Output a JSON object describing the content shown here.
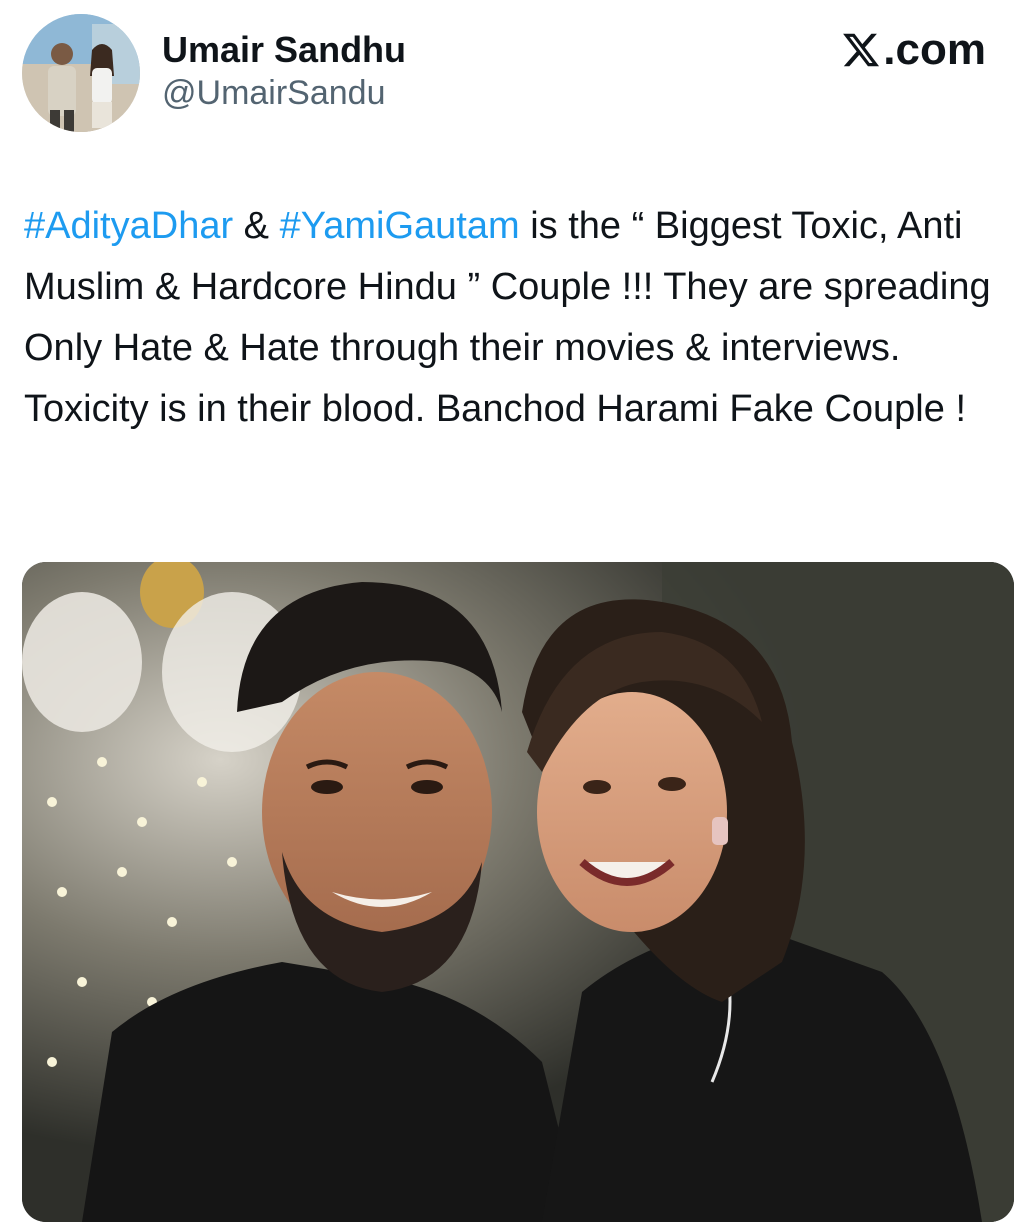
{
  "author": {
    "display_name": "Umair Sandhu",
    "handle": "@UmairSandu"
  },
  "brand": {
    "label": ".com",
    "logo_icon": "x-logo-icon"
  },
  "tweet": {
    "segments": [
      {
        "text": "#AdityaDhar",
        "type": "hashtag"
      },
      {
        "text": " & ",
        "type": "text"
      },
      {
        "text": "#YamiGautam",
        "type": "hashtag"
      },
      {
        "text": " is the “ Biggest Toxic, Anti Muslim & Hardcore Hindu ” Couple !!! They are spreading Only Hate & Hate through their movies & interviews. Toxicity is in their blood. Banchod Harami Fake Couple !",
        "type": "text"
      }
    ]
  },
  "colors": {
    "hashtag": "#1d9bf0",
    "text": "#0f1419",
    "secondary": "#536471"
  }
}
